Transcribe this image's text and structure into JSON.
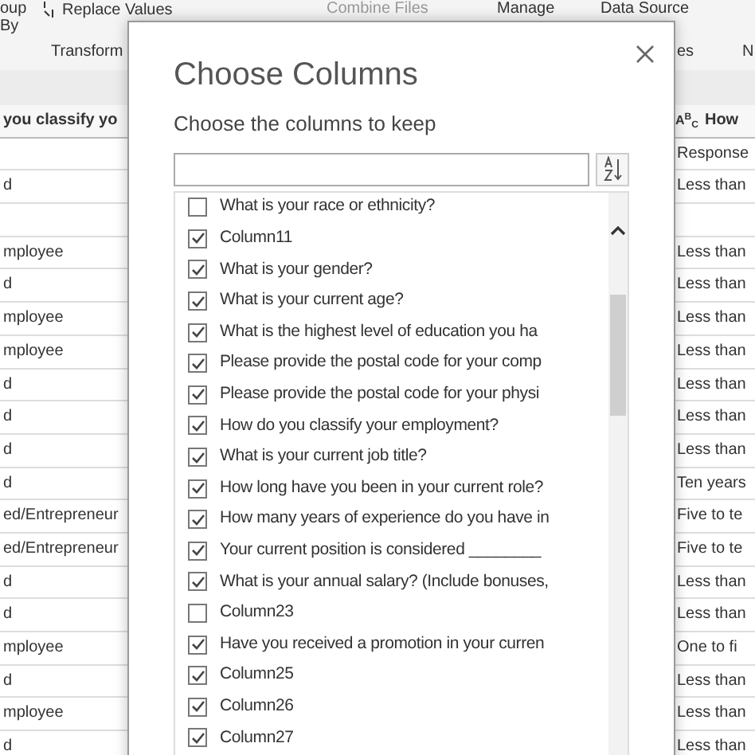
{
  "ribbon": {
    "group_by": "oup By",
    "replace_values": "Replace Values",
    "combine_files": "Combine Files",
    "manage": "Manage",
    "data_source": "Data Source",
    "group_labels": [
      "Transform",
      "es",
      "N"
    ]
  },
  "table": {
    "columns": [
      {
        "label": "you classify yo"
      },
      {
        "type_label": "A$^{B}$$_{C}$",
        "label": "How"
      }
    ],
    "rows": [
      {
        "column_1": "",
        "column_2": "Response"
      },
      {
        "column_1": "d",
        "column_2": "Less than"
      },
      {
        "column_1": "",
        "column_2": ""
      },
      {
        "column_1": "mployee",
        "column_2": "Less than"
      },
      {
        "column_1": "d",
        "column_2": "Less than"
      },
      {
        "column_1": "mployee",
        "column_2": "Less than"
      },
      {
        "column_1": "mployee",
        "column_2": "Less than"
      },
      {
        "column_1": "d",
        "column_2": "Less than"
      },
      {
        "column_1": "d",
        "column_2": "Less than"
      },
      {
        "column_1": "d",
        "column_2": "Less than"
      },
      {
        "column_1": "d",
        "column_2": "Ten years"
      },
      {
        "column_1": "ed/Entrepreneur",
        "column_2": "Five to te"
      },
      {
        "column_1": "ed/Entrepreneur",
        "column_2": "Five to te"
      },
      {
        "column_1": "d",
        "column_2": "Less than"
      },
      {
        "column_1": "d",
        "column_2": "Less than"
      },
      {
        "column_1": "mployee",
        "column_2": "One to fi"
      },
      {
        "column_1": "d",
        "column_2": "Less than"
      },
      {
        "column_1": "mployee",
        "column_2": "Less than"
      },
      {
        "column_1": "d",
        "column_2": "Less than"
      }
    ]
  },
  "dialog": {
    "title": "Choose Columns",
    "subtitle": "Choose the columns to keep",
    "columns": [
      {
        "label": "What is your race or ethnicity?",
        "checked": false
      },
      {
        "label": "Column11",
        "checked": true
      },
      {
        "label": "What is your gender?",
        "checked": true
      },
      {
        "label": "What is your current age?",
        "checked": true
      },
      {
        "label": "What is the highest level of education you ha",
        "checked": true
      },
      {
        "label": "Please provide the postal code for your comp",
        "checked": true
      },
      {
        "label": "Please provide the postal code for your physi",
        "checked": true
      },
      {
        "label": "How do you classify your employment?",
        "checked": true
      },
      {
        "label": "What is your current job title?",
        "checked": true
      },
      {
        "label": "How long have you been in your current role?",
        "checked": true
      },
      {
        "label": "How many years of experience do you have in",
        "checked": true
      },
      {
        "label": "Your current position is considered ________",
        "checked": true
      },
      {
        "label": "What is your annual salary? (Include bonuses,",
        "checked": true
      },
      {
        "label": "Column23",
        "checked": false
      },
      {
        "label": "Have you received a promotion in your curren",
        "checked": true
      },
      {
        "label": "Column25",
        "checked": true
      },
      {
        "label": "Column26",
        "checked": true
      },
      {
        "label": "Column27",
        "checked": true
      }
    ]
  }
}
